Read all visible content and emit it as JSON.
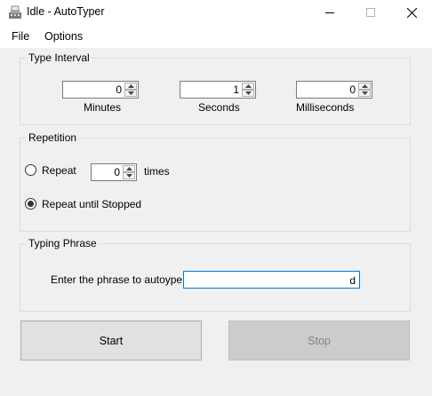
{
  "window": {
    "title": "Idle - AutoTyper",
    "icon": "typewriter-icon"
  },
  "menu": {
    "items": [
      "File",
      "Options"
    ]
  },
  "type_interval": {
    "label": "Type Interval",
    "minutes": {
      "value": "0",
      "label": "Minutes"
    },
    "seconds": {
      "value": "1",
      "label": "Seconds"
    },
    "milliseconds": {
      "value": "0",
      "label": "Milliseconds"
    }
  },
  "repetition": {
    "label": "Repetition",
    "repeat": {
      "label": "Repeat",
      "selected": false,
      "count": "0",
      "suffix": "times"
    },
    "until_stopped": {
      "label": "Repeat until Stopped",
      "selected": true
    }
  },
  "typing_phrase": {
    "label": "Typing Phrase",
    "prompt": "Enter the phrase to autoype:",
    "value": "d"
  },
  "buttons": {
    "start": {
      "label": "Start",
      "enabled": true
    },
    "stop": {
      "label": "Stop",
      "enabled": false
    }
  }
}
